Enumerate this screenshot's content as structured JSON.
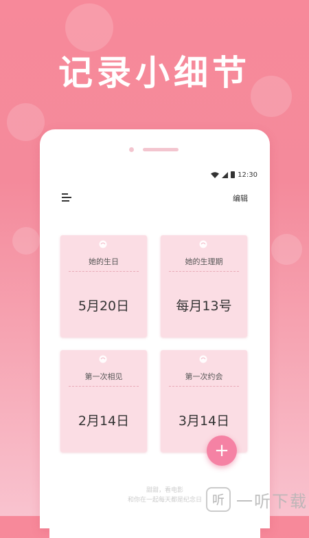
{
  "headline": "记录小细节",
  "status_bar": {
    "time": "12:30"
  },
  "toolbar": {
    "edit_label": "编辑"
  },
  "cards": [
    {
      "label": "她的生日",
      "value": "5月20日"
    },
    {
      "label": "她的生理期",
      "value": "每月13号"
    },
    {
      "label": "第一次相见",
      "value": "2月14日"
    },
    {
      "label": "第一次约会",
      "value": "3月14日"
    }
  ],
  "fab": {
    "label": "+"
  },
  "footer": {
    "line1": "甜甜，看电影",
    "line2": "和你在一起每天都是纪念日"
  },
  "watermark": {
    "logo_text": "听",
    "text": "一听下载"
  },
  "colors": {
    "background": "#f7899a",
    "card": "#fbdde4",
    "fab": "#f582a4"
  }
}
